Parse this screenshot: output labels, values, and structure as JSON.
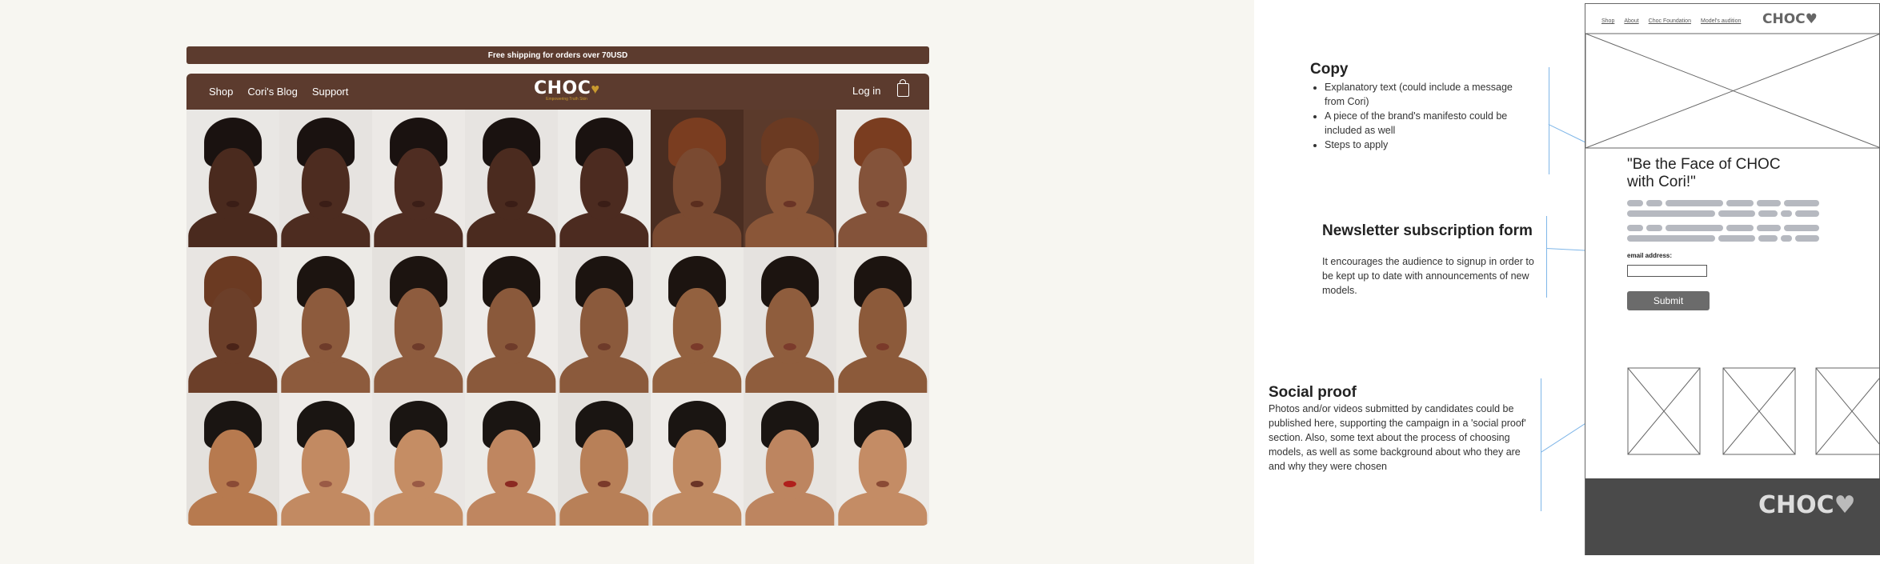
{
  "announcement": "Free shipping for orders over 70USD",
  "nav": {
    "links": [
      "Shop",
      "Cori's Blog",
      "Support"
    ],
    "logo": "CHOC",
    "logo_tagline": "Empowering Truth Skin",
    "login": "Log in",
    "cart_count": "0"
  },
  "photos": [
    {
      "skin": "#4a2a1e",
      "bg": "#e9e7e4",
      "hair": "#1a1210",
      "lips": "#3a1d16"
    },
    {
      "skin": "#4d2c20",
      "bg": "#e6e3e0",
      "hair": "#1a1210",
      "lips": "#3a1d16"
    },
    {
      "skin": "#4f2d22",
      "bg": "#ece9e6",
      "hair": "#1a1210",
      "lips": "#3b1e17"
    },
    {
      "skin": "#4b2b1f",
      "bg": "#e7e4e1",
      "hair": "#1a1210",
      "lips": "#3a1d16"
    },
    {
      "skin": "#4c2b20",
      "bg": "#eceae7",
      "hair": "#1a1210",
      "lips": "#3a1d16"
    },
    {
      "skin": "#7a4a31",
      "bg": "#4a2d21",
      "hair": "#7a3d20",
      "lips": "#5a2d1e"
    },
    {
      "skin": "#8a5638",
      "bg": "#5b3a2b",
      "hair": "#6b3a22",
      "lips": "#6a3426"
    },
    {
      "skin": "#84533a",
      "bg": "#eae7e3",
      "hair": "#7a3d20",
      "lips": "#6a3426"
    },
    {
      "skin": "#6c3f29",
      "bg": "#e8e5e2",
      "hair": "#6b3a22",
      "lips": "#4a2318"
    },
    {
      "skin": "#8d5b3d",
      "bg": "#eceae6",
      "hair": "#1c1410",
      "lips": "#6e3b2a"
    },
    {
      "skin": "#8e5c3e",
      "bg": "#e4e1dd",
      "hair": "#1c1410",
      "lips": "#6e3b2a"
    },
    {
      "skin": "#8a593b",
      "bg": "#eeebe8",
      "hair": "#1c1410",
      "lips": "#6e3b2a"
    },
    {
      "skin": "#8b5a3c",
      "bg": "#e6e3e0",
      "hair": "#1c1410",
      "lips": "#6e3b2a"
    },
    {
      "skin": "#93613f",
      "bg": "#eceae6",
      "hair": "#1c1410",
      "lips": "#7a3a2a"
    },
    {
      "skin": "#8f5d3d",
      "bg": "#e5e2df",
      "hair": "#1c1410",
      "lips": "#7b3b2c"
    },
    {
      "skin": "#8c5a3a",
      "bg": "#ebe8e4",
      "hair": "#1c1410",
      "lips": "#7a3a2a"
    },
    {
      "skin": "#b77a4f",
      "bg": "#e4e1dd",
      "hair": "#1a1512",
      "lips": "#8a4a35"
    },
    {
      "skin": "#c28a62",
      "bg": "#eeebe8",
      "hair": "#1a1512",
      "lips": "#9a5a45"
    },
    {
      "skin": "#c58d64",
      "bg": "#e9e6e3",
      "hair": "#1a1512",
      "lips": "#9a5a45"
    },
    {
      "skin": "#bf8660",
      "bg": "#eceae6",
      "hair": "#1a1512",
      "lips": "#8b2a22"
    },
    {
      "skin": "#b88058",
      "bg": "#e3e0dc",
      "hair": "#1a1512",
      "lips": "#7a3a2a"
    },
    {
      "skin": "#c08a62",
      "bg": "#eeebe8",
      "hair": "#1a1512",
      "lips": "#6a3426"
    },
    {
      "skin": "#bd8560",
      "bg": "#e7e4e0",
      "hair": "#1a1512",
      "lips": "#b0201c"
    },
    {
      "skin": "#c48c65",
      "bg": "#ece9e5",
      "hair": "#1a1512",
      "lips": "#8a4a35"
    }
  ],
  "annotations": {
    "copy": {
      "title": "Copy",
      "bullets": [
        "Explanatory text (could include a message from Cori)",
        "A piece of the brand's manifesto could be included as well",
        "Steps to apply"
      ]
    },
    "newsletter": {
      "title": "Newsletter subscription form",
      "text": "It encourages  the audience to signup in order to be kept up to date with announcements of new models."
    },
    "social": {
      "title": "Social proof",
      "text": "Photos and/or videos submitted by candidates could be published here, supporting the campaign in a 'social proof' section. Also, some text about the process of choosing models, as well as some background about who they are and why they were chosen"
    }
  },
  "wireframe": {
    "nav": [
      "Shop",
      "About",
      "Choc Foundation",
      "Model's audition"
    ],
    "logo": "CHOC",
    "heading": "\"Be the Face of CHOC with Cori!\"",
    "email_label": "email address:",
    "submit": "Submit",
    "footer_logo": "CHOC"
  },
  "colors": {
    "brand_brown": "#5c3b2e",
    "gold": "#c99a2e",
    "annotation_line": "#7fb6e8"
  }
}
